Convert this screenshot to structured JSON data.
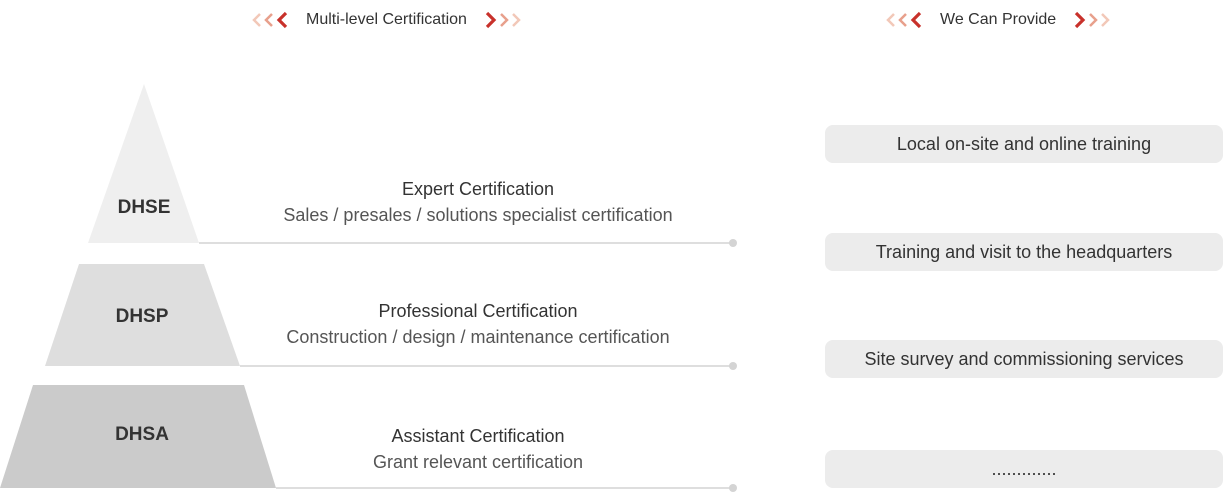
{
  "headings": {
    "left": "Multi-level Certification",
    "right": "We Can Provide"
  },
  "colors": {
    "accent": "#c8312b",
    "accent_light": "#e8a08c",
    "accent_pale": "#f2c8b8",
    "tier_top": "#efefef",
    "tier_mid": "#dedede",
    "tier_bottom": "#cbcbcb",
    "service_bg": "#ececec",
    "divider": "#d4d4d4"
  },
  "levels": [
    {
      "code": "DHSE",
      "title": "Expert Certification",
      "description": "Sales / presales / solutions specialist certification"
    },
    {
      "code": "DHSP",
      "title": "Professional Certification",
      "description": "Construction / design / maintenance certification"
    },
    {
      "code": "DHSA",
      "title": "Assistant Certification",
      "description": "Grant relevant certification"
    }
  ],
  "services": [
    "Local on-site and online training",
    "Training and visit to the headquarters",
    "Site survey and commissioning services",
    "............."
  ],
  "icons": {
    "left_chevrons": "double-chevron-left-icon",
    "right_chevrons": "double-chevron-right-icon"
  }
}
